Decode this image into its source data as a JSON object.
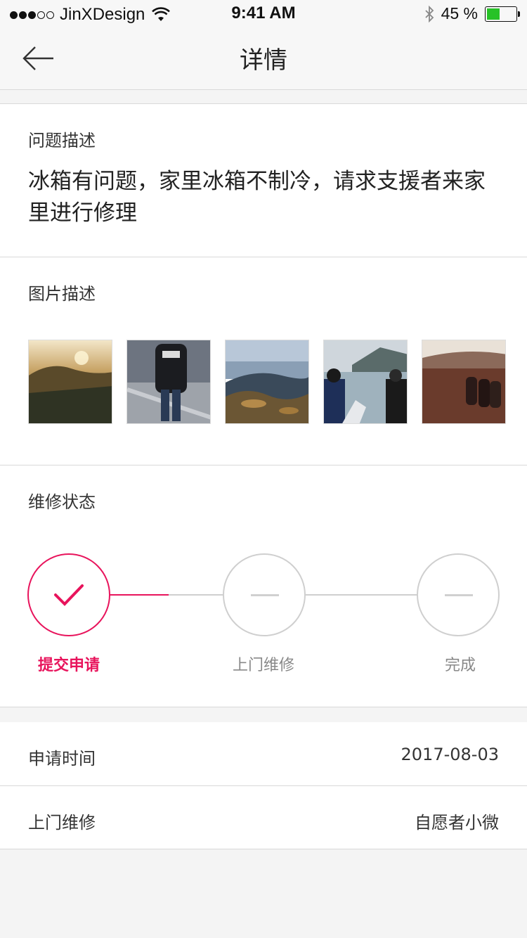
{
  "status_bar": {
    "carrier": "JinXDesign",
    "time": "9:41 AM",
    "battery": "45 %",
    "battery_level": 0.45
  },
  "nav": {
    "title": "详情"
  },
  "problem": {
    "label": "问题描述",
    "text": "冰箱有问题，家里冰箱不制冷，请求支援者来家里进行修理"
  },
  "images": {
    "label": "图片描述"
  },
  "repair_status": {
    "label": "维修状态",
    "steps": [
      "提交申请",
      "上门维修",
      "完成"
    ],
    "accent": "#e8145c"
  },
  "info_rows": [
    {
      "key": "申请时间",
      "value": "2017-08-03"
    },
    {
      "key": "上门维修",
      "value": "自愿者小微"
    }
  ]
}
